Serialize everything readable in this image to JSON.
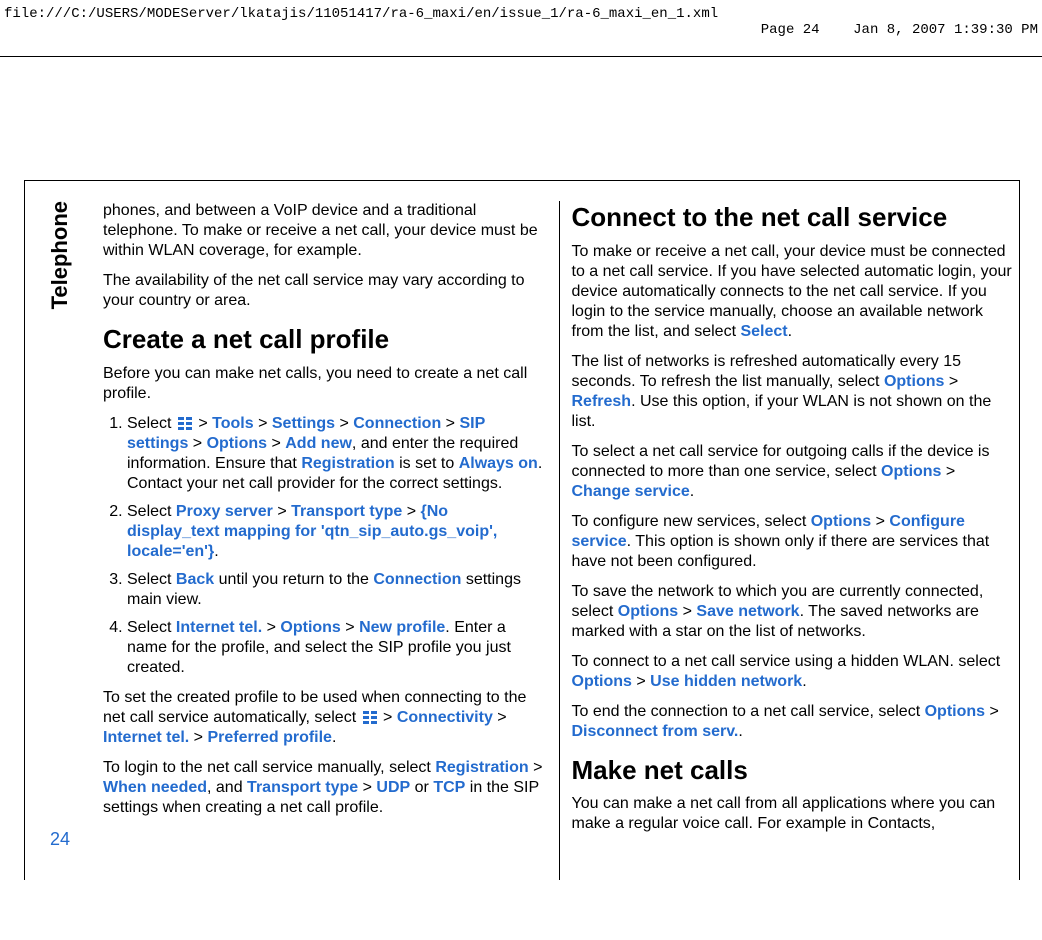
{
  "header": {
    "path": "file:///C:/USERS/MODEServer/lkatajis/11051417/ra-6_maxi/en/issue_1/ra-6_maxi_en_1.xml",
    "page": "Page 24",
    "date": "Jan 8, 2007 1:39:30 PM"
  },
  "side_tab": "Telephone",
  "page_number": "24",
  "left": {
    "intro1": "phones, and between a VoIP device and a traditional telephone. To make or receive a net call, your device must be within WLAN coverage, for example.",
    "intro2": "The availability of the net call service may vary according to your country or area.",
    "create_title": "Create a net call profile",
    "create_intro": "Before you can make net calls, you need to create a net call profile.",
    "step1_a": "Select ",
    "step1_tools": "Tools",
    "step1_settings": "Settings",
    "step1_connection": "Connection",
    "step1_sip": "SIP settings",
    "step1_options": "Options",
    "step1_addnew": "Add new",
    "step1_b": ", and enter the required information. Ensure that ",
    "step1_registration": "Registration",
    "step1_c": " is set to ",
    "step1_alwayson": "Always on",
    "step1_d": ". Contact your net call provider for the correct settings.",
    "step2_a": "Select ",
    "step2_proxy": "Proxy server",
    "step2_transport": "Transport type",
    "step2_mapping": "{No display_text mapping for 'qtn_sip_auto.gs_voip', locale='en'}",
    "step2_b": ".",
    "step3_a": "Select ",
    "step3_back": "Back",
    "step3_b": " until you return to the ",
    "step3_conn": "Connection",
    "step3_c": " settings main view.",
    "step4_a": "Select ",
    "step4_inttel": "Internet tel.",
    "step4_options": "Options",
    "step4_newprofile": "New profile",
    "step4_b": ". Enter a name for the profile, and select the SIP profile you just created.",
    "auto1_a": "To set the created profile to be used when connecting to the net call service automatically, select ",
    "auto1_conn": "Connectivity",
    "auto1_inttel": "Internet tel.",
    "auto1_pref": "Preferred profile",
    "auto1_b": ".",
    "manual_a": "To login to the net call service manually, select ",
    "manual_reg": "Registration",
    "manual_when": "When needed",
    "manual_b": ", and ",
    "manual_transport": "Transport type",
    "manual_udp": "UDP",
    "manual_or": " or ",
    "manual_tcp": "TCP",
    "manual_c": " in the SIP settings when creating a net call profile."
  },
  "right": {
    "connect_title": "Connect to the net call service",
    "connect_intro_a": "To make or receive a net call, your device must be connected to a net call service. If you have selected automatic login, your device automatically connects to the net call service. If you login to the service manually, choose an available network from the list, and select ",
    "connect_select": "Select",
    "connect_intro_b": ".",
    "refresh_a": "The list of networks is refreshed automatically every 15 seconds. To refresh the list manually, select ",
    "refresh_options": "Options",
    "refresh_refresh": "Refresh",
    "refresh_b": ". Use this option, if your WLAN is not shown on the list.",
    "service_a": "To select a net call service for outgoing calls if the device is connected to more than one service, select ",
    "service_options": "Options",
    "service_change": "Change service",
    "service_b": ".",
    "config_a": "To configure new services, select ",
    "config_options": "Options",
    "config_conf": "Configure service",
    "config_b": ". This option is shown only if there are services that have not been configured.",
    "save_a": "To save the network to which you are currently connected, select ",
    "save_options": "Options",
    "save_save": "Save network",
    "save_b": ". The saved networks are marked with a star on the list of networks.",
    "hidden_a": "To connect to a net call service using a hidden WLAN. select ",
    "hidden_options": "Options",
    "hidden_use": "Use hidden network",
    "hidden_b": ".",
    "end_a": "To end the connection to a net call service, select ",
    "end_options": "Options",
    "end_disc": "Disconnect from serv.",
    "end_b": ".",
    "make_title": "Make net calls",
    "make_body": "You can make a net call from all applications where you can make a regular voice call. For example in Contacts,"
  },
  "gt": " > "
}
